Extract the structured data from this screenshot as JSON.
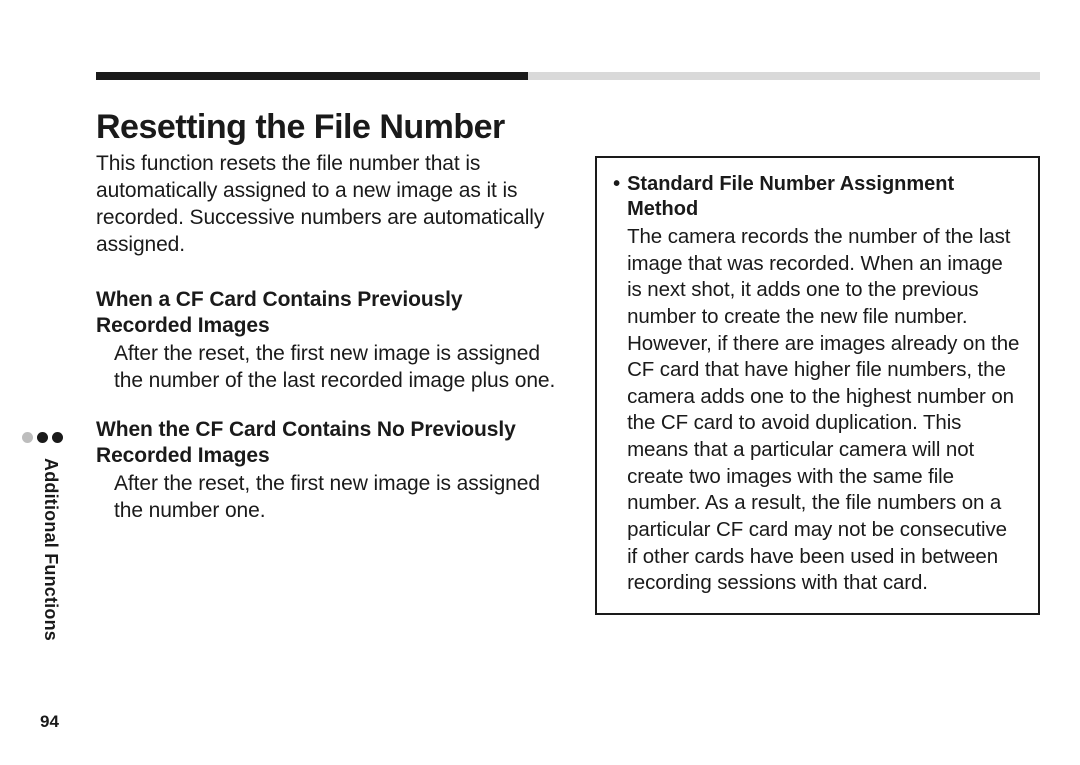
{
  "pageNumber": "94",
  "sideTab": "Additional Functions",
  "title": "Resetting the File Number",
  "intro": "This function resets the file number that is automatically assigned to a new image as it is recorded. Successive numbers are automati­cally assigned.",
  "sections": [
    {
      "heading": "When a CF Card Contains Previously Recorded Images",
      "body": "After the reset, the first new image is assigned the number of the last recorded image plus one."
    },
    {
      "heading": "When the CF Card Contains No Previously Recorded Images",
      "body": "After the reset, the first new image is assigned the number one."
    }
  ],
  "infoBox": {
    "bullet": "•",
    "heading": "Standard File Number Assignment Method",
    "body": "The camera records the number of the last image that was recorded. When an image is next shot, it adds one to the previous number to create the new file number. However, if there are images already on the CF card that have higher file numbers, the camera adds one to the highest number on the CF card to avoid duplication. This means that a particular camera will not create two images with the same file number. As a result, the file numbers on a particular CF card may not be consecutive if other cards have been used in between recording sessions with that card."
  }
}
